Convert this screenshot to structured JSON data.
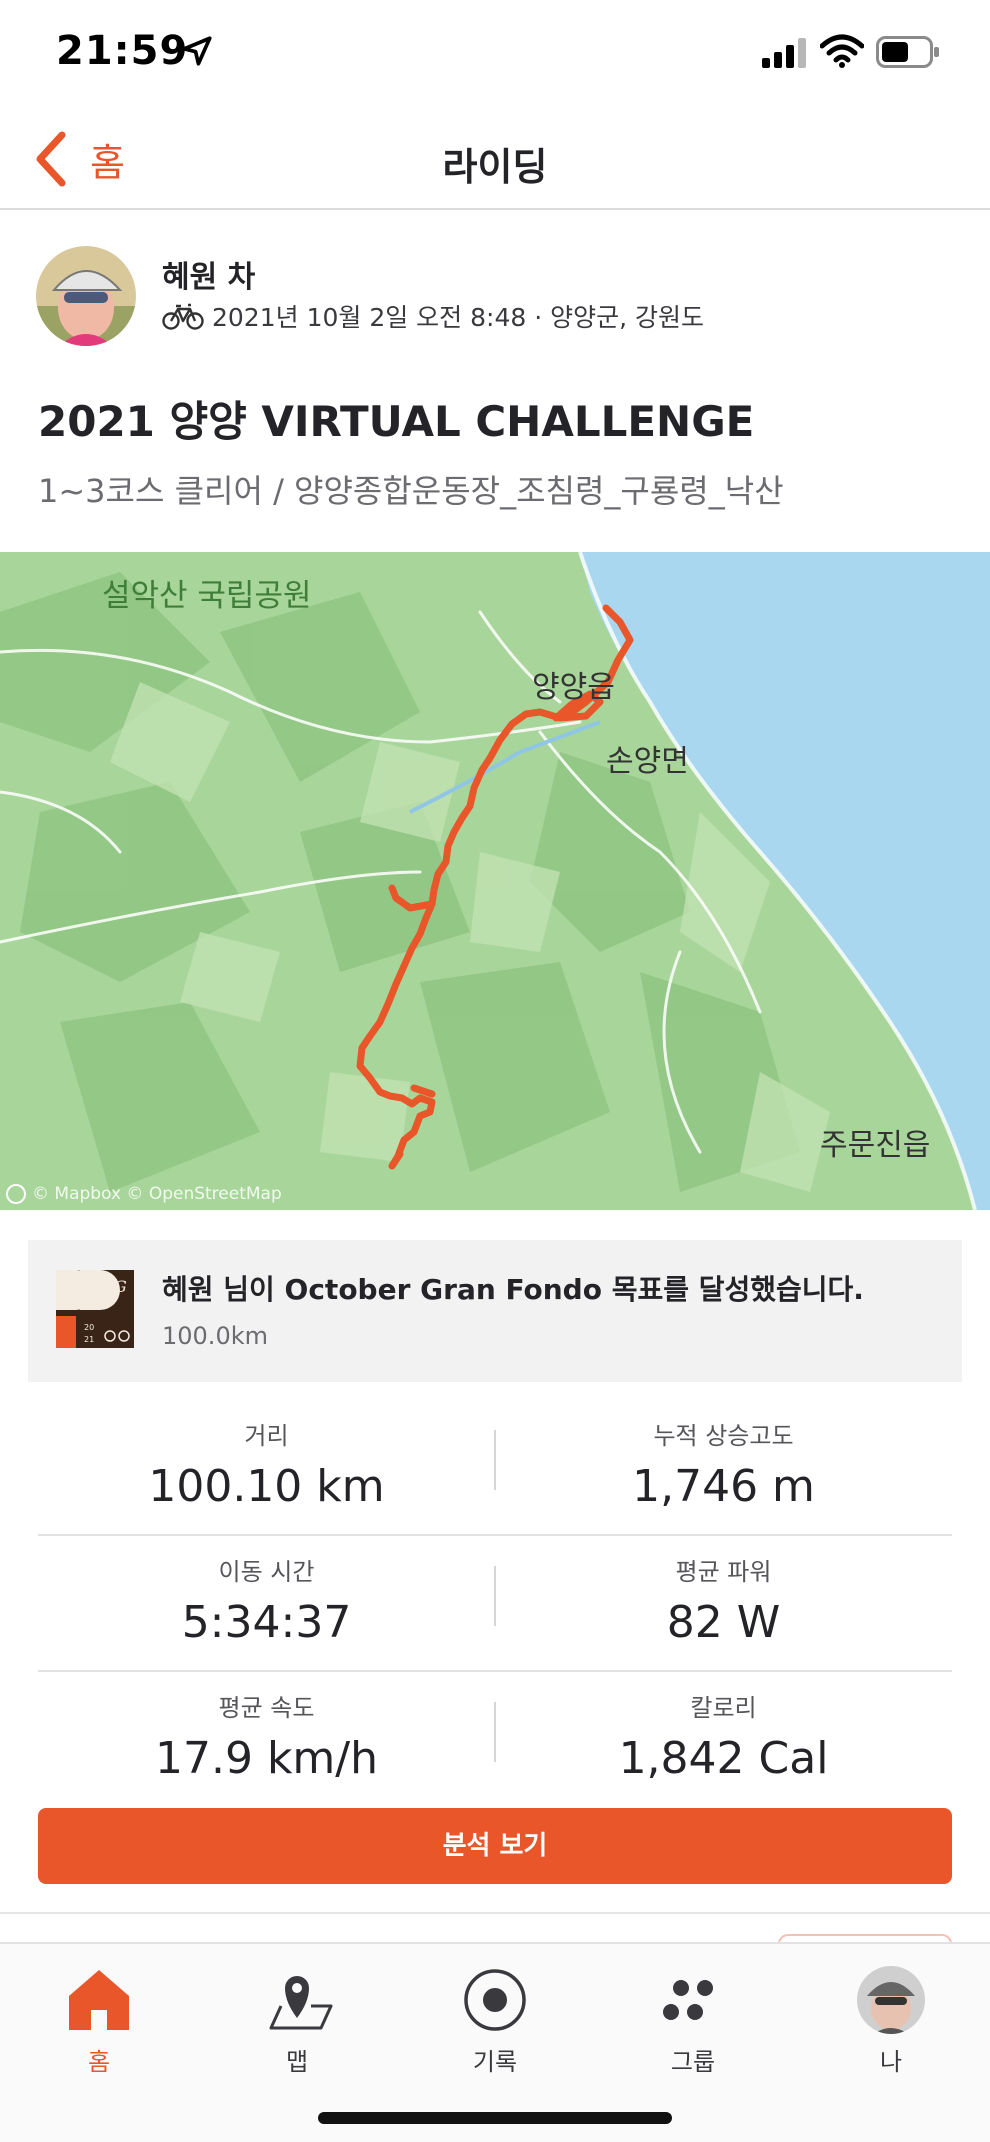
{
  "status_bar": {
    "time": "21:59"
  },
  "nav": {
    "back_label": "홈",
    "title": "라이딩"
  },
  "athlete": {
    "name": "혜원 차",
    "meta": "2021년 10월 2일 오전 8:48 · 양양군, 강원도"
  },
  "activity": {
    "title": "2021 양양 VIRTUAL CHALLENGE",
    "description": "1~3코스 클리어 / 양양종합운동장_조침령_구룡령_낙산"
  },
  "map": {
    "labels": {
      "park": "설악산 국립공원",
      "town1": "양양읍",
      "town2": "손양면",
      "town3": "주문진읍"
    },
    "attribution": "© Mapbox © OpenStreetMap",
    "route_color": "#e8562a"
  },
  "achievement": {
    "title": "혜원 님이 October Gran Fondo 목표를 달성했습니다.",
    "subtitle": "100.0km"
  },
  "stats": [
    {
      "left": {
        "label": "거리",
        "value": "100.10 km"
      },
      "right": {
        "label": "누적 상승고도",
        "value": "1,746 m"
      }
    },
    {
      "left": {
        "label": "이동 시간",
        "value": "5:34:37"
      },
      "right": {
        "label": "평균 파워",
        "value": "82 W"
      }
    },
    {
      "left": {
        "label": "평균 속도",
        "value": "17.9 km/h"
      },
      "right": {
        "label": "칼로리",
        "value": "1,842 Cal"
      }
    }
  ],
  "analysis_button": "분석 보기",
  "tabs": [
    {
      "label": "홈",
      "icon": "home-icon",
      "active": true
    },
    {
      "label": "맵",
      "icon": "map-icon",
      "active": false
    },
    {
      "label": "기록",
      "icon": "record-icon",
      "active": false
    },
    {
      "label": "그룹",
      "icon": "groups-icon",
      "active": false
    },
    {
      "label": "나",
      "icon": "profile-avatar",
      "active": false
    }
  ],
  "colors": {
    "accent": "#e8562a",
    "sea": "#a9d7ef",
    "land": "#a8d59a"
  }
}
